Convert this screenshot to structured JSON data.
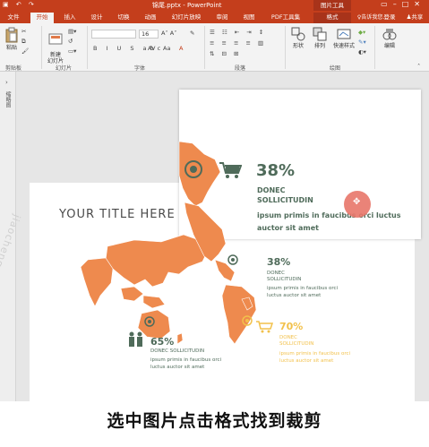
{
  "titlebar": {
    "title": "锦尾.pptx - PowerPoint",
    "context_tool": "图片工具",
    "qa_icons": [
      "save-icon",
      "undo-icon",
      "redo-icon"
    ]
  },
  "tabs": [
    {
      "label": "文件"
    },
    {
      "label": "开始"
    },
    {
      "label": "插入"
    },
    {
      "label": "设计"
    },
    {
      "label": "切换"
    },
    {
      "label": "动画"
    },
    {
      "label": "幻灯片放映"
    },
    {
      "label": "审阅"
    },
    {
      "label": "视图"
    },
    {
      "label": "PDF工具集"
    },
    {
      "label": "格式"
    }
  ],
  "tell_me": "告诉我您...",
  "login": "登录",
  "share": "共享",
  "ribbon": {
    "paste": "粘贴",
    "new_slide": "新建\n幻灯片",
    "clipboard_group": "剪贴板",
    "slides_group": "幻灯片",
    "font_group": "字体",
    "paragraph_group": "段落",
    "drawing_group": "绘图",
    "font_size": "16",
    "shape": "形状",
    "arrange": "排列",
    "quick_style": "快速样式",
    "edit": "编辑"
  },
  "left_pane": {
    "label": "缩略图"
  },
  "slide": {
    "title": "YOUR TITLE HERE",
    "big_stat": {
      "percent": "38%",
      "heading": "DONEC SOLLICITUDIN",
      "text": "ipsum primis in faucibus orci luctus auctor sit amet"
    },
    "stats": [
      {
        "percent": "38%",
        "heading": "DONEC SOLLICITUDIN",
        "text": "ipsum primis in faucibus orci luctus auctor sit amet"
      },
      {
        "percent": "65%",
        "heading": "DONEC SOLLICITUDIN",
        "text": "ipsum primis in faucibus orci luctus auctor sit amet"
      },
      {
        "percent": "70%",
        "heading": "DONEC SOLLICITUDIN",
        "text": "ipsum primis in faucibus orci luctus auctor sit amet"
      }
    ],
    "watermark": "jiaocheng"
  },
  "subtitle": "选中图片点击格式找到裁剪",
  "colors": {
    "accent": "#c43e1c",
    "map_orange": "#ee8a4e",
    "stat_green": "#4f6b5a",
    "stat_yellow": "#f2c14b"
  }
}
